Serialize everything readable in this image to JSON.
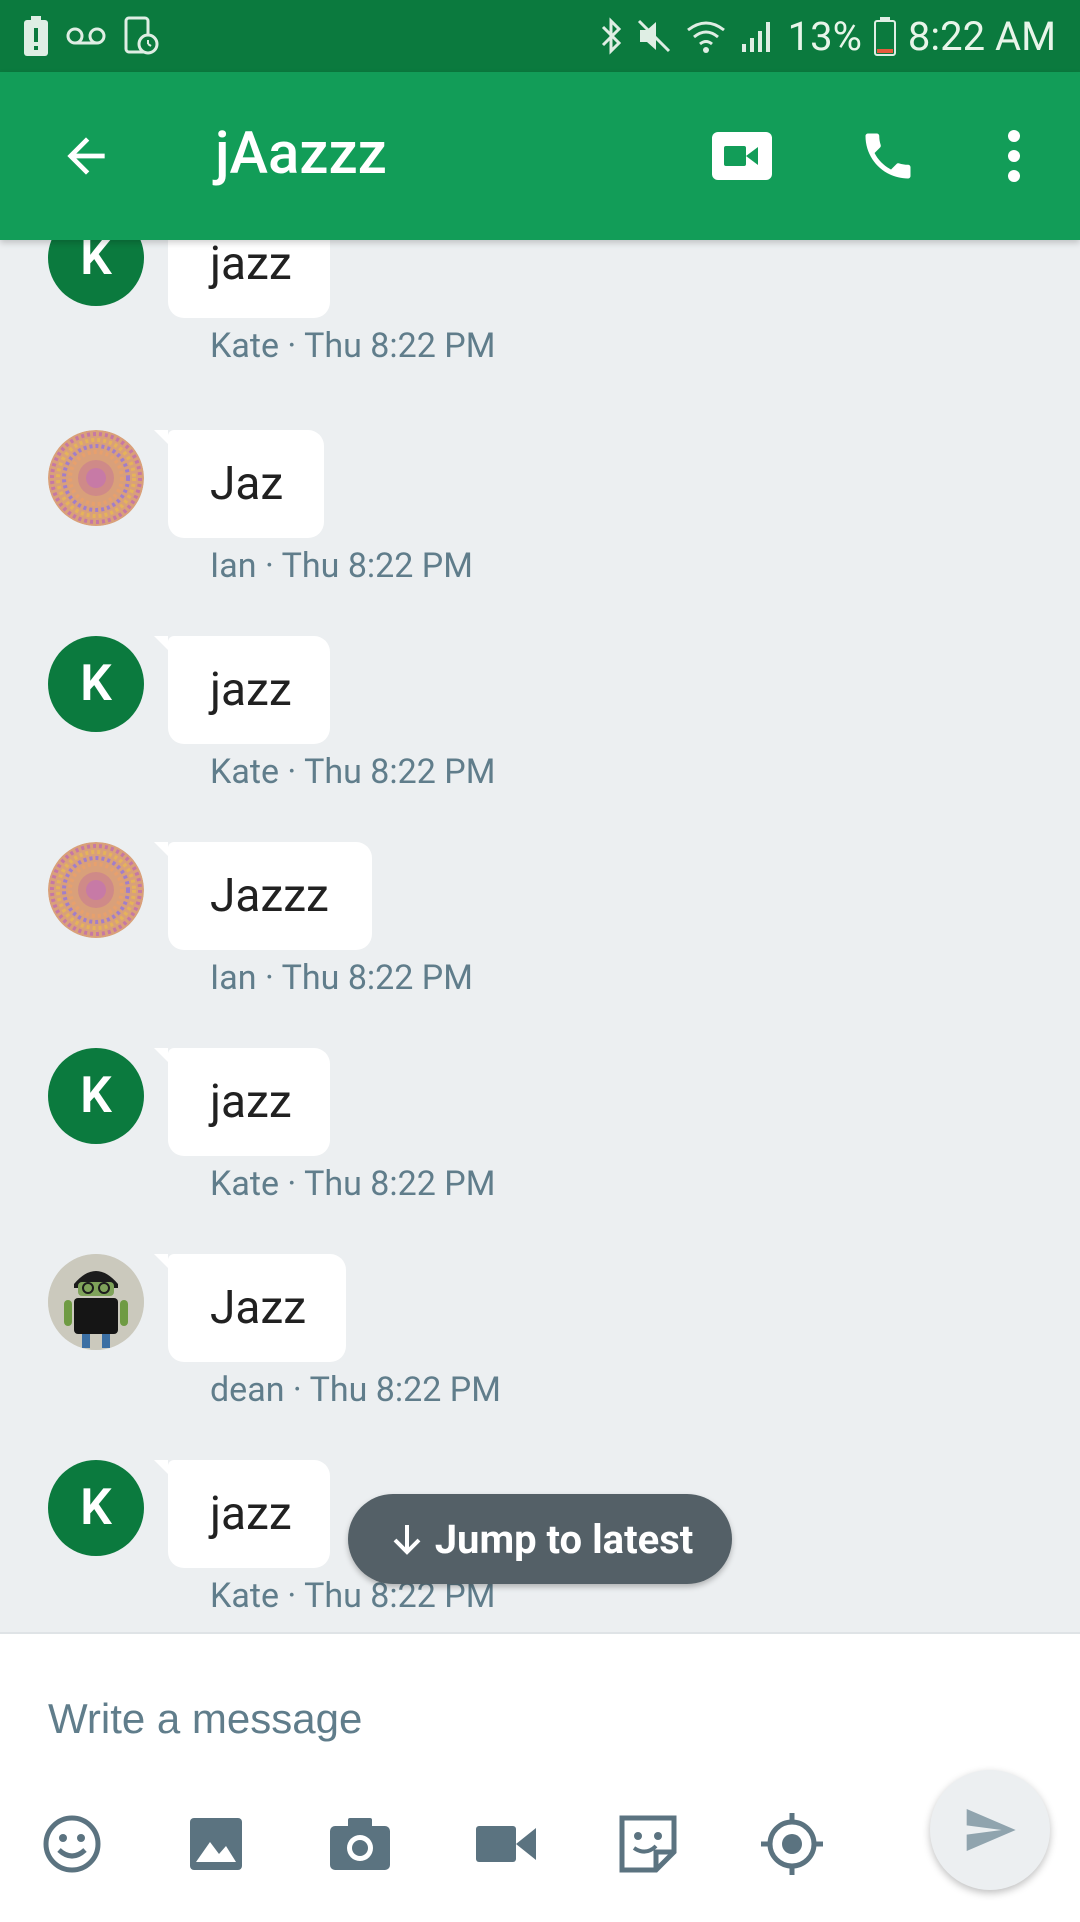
{
  "status_bar": {
    "battery_percent": "13%",
    "time": "8:22 AM"
  },
  "app_bar": {
    "title": "jAazzz"
  },
  "messages": [
    {
      "text": "jazz",
      "sender": "Kate",
      "time": "Thu 8:22 PM",
      "avatar": "K"
    },
    {
      "text": "Jaz",
      "sender": "Ian",
      "time": "Thu 8:22 PM",
      "avatar": "pattern"
    },
    {
      "text": "jazz",
      "sender": "Kate",
      "time": "Thu 8:22 PM",
      "avatar": "K"
    },
    {
      "text": "Jazzz",
      "sender": "Ian",
      "time": "Thu 8:22 PM",
      "avatar": "pattern"
    },
    {
      "text": "jazz",
      "sender": "Kate",
      "time": "Thu 8:22 PM",
      "avatar": "K"
    },
    {
      "text": "Jazz",
      "sender": "dean",
      "time": "Thu 8:22 PM",
      "avatar": "android"
    },
    {
      "text": "jazz",
      "sender": "Kate",
      "time": "Thu 8:22 PM",
      "avatar": "K"
    }
  ],
  "jump_to_latest": "Jump to latest",
  "composer": {
    "placeholder": "Write a message"
  },
  "colors": {
    "status_bar": "#0b7a3e",
    "app_bar": "#129d58",
    "avatar_k": "#0b7a3e",
    "background": "#eceff1",
    "icon_gray": "#5b7380"
  }
}
